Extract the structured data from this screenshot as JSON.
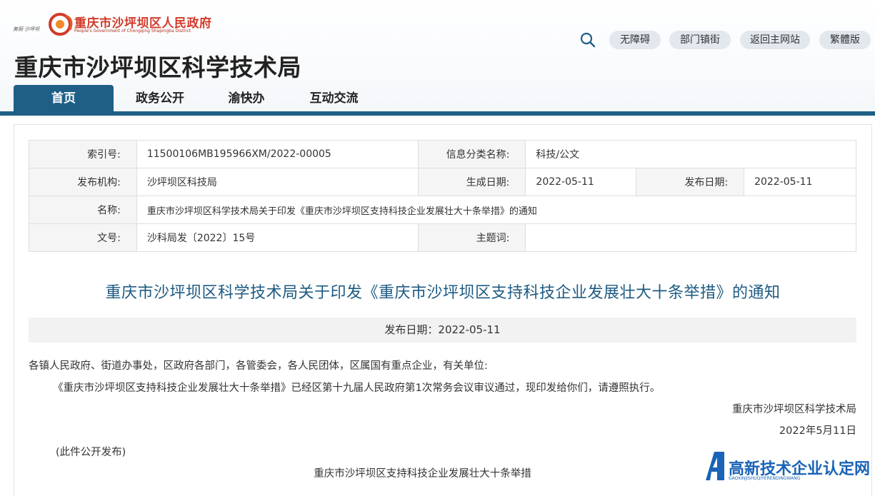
{
  "header": {
    "logo_cn": "重庆市沙坪坝区人民政府",
    "logo_en": "People's Government of Chongqing Shapingba District",
    "logo_small": "美丽·沙坪坝",
    "site_title": "重庆市沙坪坝区科学技术局",
    "tools": [
      "无障碍",
      "部门镇街",
      "返回主网站",
      "繁體版"
    ]
  },
  "nav": {
    "items": [
      "首页",
      "政务公开",
      "渝快办",
      "互动交流"
    ],
    "active": 0
  },
  "meta": {
    "index_label": "索引号:",
    "index_value": "11500106MB195966XM/2022-00005",
    "category_label": "信息分类名称:",
    "category_value": "科技/公文",
    "publisher_label": "发布机构:",
    "publisher_value": "沙坪坝区科技局",
    "created_label": "生成日期:",
    "created_value": "2022-05-11",
    "published_label": "发布日期:",
    "published_value": "2022-05-11",
    "name_label": "名称:",
    "name_value": "重庆市沙坪坝区科学技术局关于印发《重庆市沙坪坝区支持科技企业发展壮大十条举措》的通知",
    "docno_label": "文号:",
    "docno_value": "沙科局发〔2022〕15号",
    "keywords_label": "主题词:",
    "keywords_value": ""
  },
  "article": {
    "title": "重庆市沙坪坝区科学技术局关于印发《重庆市沙坪坝区支持科技企业发展壮大十条举措》的通知",
    "date_line": "发布日期：2022-05-11",
    "salutation": "各镇人民政府、街道办事处，区政府各部门，各管委会，各人民团体，区属国有重点企业，有关单位:",
    "body": "《重庆市沙坪坝区支持科技企业发展壮大十条举措》已经区第十九届人民政府第1次常务会议审议通过，现印发给你们，请遵照执行。",
    "signature": "重庆市沙坪坝区科学技术局",
    "sign_date": "2022年5月11日",
    "note": "(此件公开发布)",
    "subtitle": "重庆市沙坪坝区支持科技企业发展壮大十条举措"
  },
  "watermark": {
    "text": "高新技术企业认定网",
    "sub": "GAOXINJISHUQIYERENDINGWANG"
  }
}
